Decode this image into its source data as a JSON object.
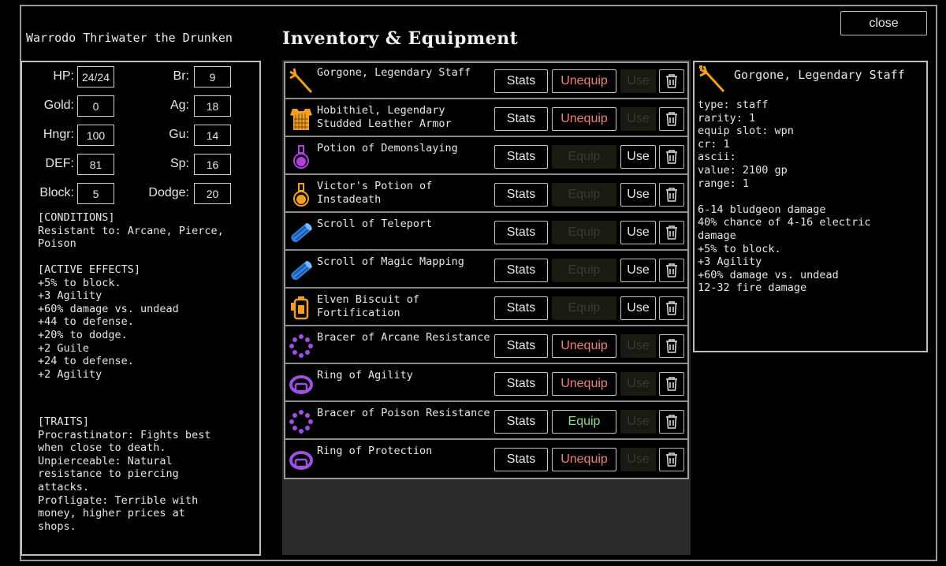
{
  "character": {
    "name": "Warrodo Thriwater the Drunken"
  },
  "title": "Inventory & Equipment",
  "close_label": "close",
  "stats": [
    {
      "label": "HP:",
      "value": "24/24"
    },
    {
      "label": "Br:",
      "value": "9"
    },
    {
      "label": "Gold:",
      "value": "0"
    },
    {
      "label": "Ag:",
      "value": "18"
    },
    {
      "label": "Hngr:",
      "value": "100"
    },
    {
      "label": "Gu:",
      "value": "14"
    },
    {
      "label": "DEF:",
      "value": "81"
    },
    {
      "label": "Sp:",
      "value": "16"
    },
    {
      "label": "Block:",
      "value": "5"
    },
    {
      "label": "Dodge:",
      "value": "20"
    }
  ],
  "conditions": {
    "text": "[CONDITIONS]\nResistant to: Arcane, Pierce,\nPoison"
  },
  "active_effects": {
    "text": "[ACTIVE EFFECTS]\n+5% to block.\n+3 Agility\n+60% damage vs. undead\n+44 to defense.\n+20% to dodge.\n+2 Guile\n+24 to defense.\n+2 Agility"
  },
  "traits": {
    "text": "[TRAITS]\nProcrastinator: Fights best\nwhen close to death.\nUnpierceable: Natural\nresistance to piercing\nattacks.\nProfligate: Terrible with\nmoney, higher prices at\nshops."
  },
  "buttons": {
    "stats": "Stats",
    "unequip": "Unequip",
    "equip": "Equip",
    "use": "Use"
  },
  "items": [
    {
      "name": "Gorgone, Legendary Staff",
      "icon": "staff-icon",
      "action": "Unequip",
      "equipped": true,
      "usable": false
    },
    {
      "name": "Hobithiel, Legendary\nStudded Leather Armor",
      "icon": "armor-icon",
      "action": "Unequip",
      "equipped": true,
      "usable": false
    },
    {
      "name": "Potion of Demonslaying",
      "icon": "potion-purple-icon",
      "action": "Equip",
      "equipped": false,
      "equip_enabled": false,
      "usable": true
    },
    {
      "name": "Victor's Potion of\nInstadeath",
      "icon": "potion-orange-icon",
      "action": "Equip",
      "equipped": false,
      "equip_enabled": false,
      "usable": true
    },
    {
      "name": "Scroll of Teleport",
      "icon": "scroll-icon",
      "action": "Equip",
      "equipped": false,
      "equip_enabled": false,
      "usable": true
    },
    {
      "name": "Scroll of Magic Mapping",
      "icon": "scroll-icon",
      "action": "Equip",
      "equipped": false,
      "equip_enabled": false,
      "usable": true
    },
    {
      "name": "Elven Biscuit of\nFortification",
      "icon": "biscuit-icon",
      "action": "Equip",
      "equipped": false,
      "equip_enabled": false,
      "usable": true
    },
    {
      "name": "Bracer of Arcane Resistance",
      "icon": "bracer-icon",
      "action": "Unequip",
      "equipped": true,
      "usable": false
    },
    {
      "name": "Ring of Agility",
      "icon": "ring-icon",
      "action": "Unequip",
      "equipped": true,
      "usable": false
    },
    {
      "name": "Bracer of Poison Resistance",
      "icon": "bracer-icon",
      "action": "Equip",
      "equipped": false,
      "equip_enabled": true,
      "usable": false
    },
    {
      "name": "Ring of Protection",
      "icon": "ring-icon",
      "action": "Unequip",
      "equipped": true,
      "usable": false
    }
  ],
  "detail": {
    "name": "Gorgone, Legendary Staff",
    "icon": "staff-icon",
    "text": "type: staff\nrarity: 1\nequip slot: wpn\ncr: 1\nascii:\nvalue: 2100 gp\nrange: 1\n\n6-14 bludgeon damage\n40% chance of 4-16 electric\ndamage\n+5% to block.\n+3 Agility\n+60% damage vs. undead\n12-32 fire damage"
  },
  "colors": {
    "unequip": "#f08080",
    "equip": "#8fd88f",
    "potion_purple": "#b040e0",
    "potion_orange": "#f0a020",
    "scroll_blue": "#2f7fe0",
    "armor_orange": "#f0a020",
    "jewel_purple": "#a050e0"
  }
}
